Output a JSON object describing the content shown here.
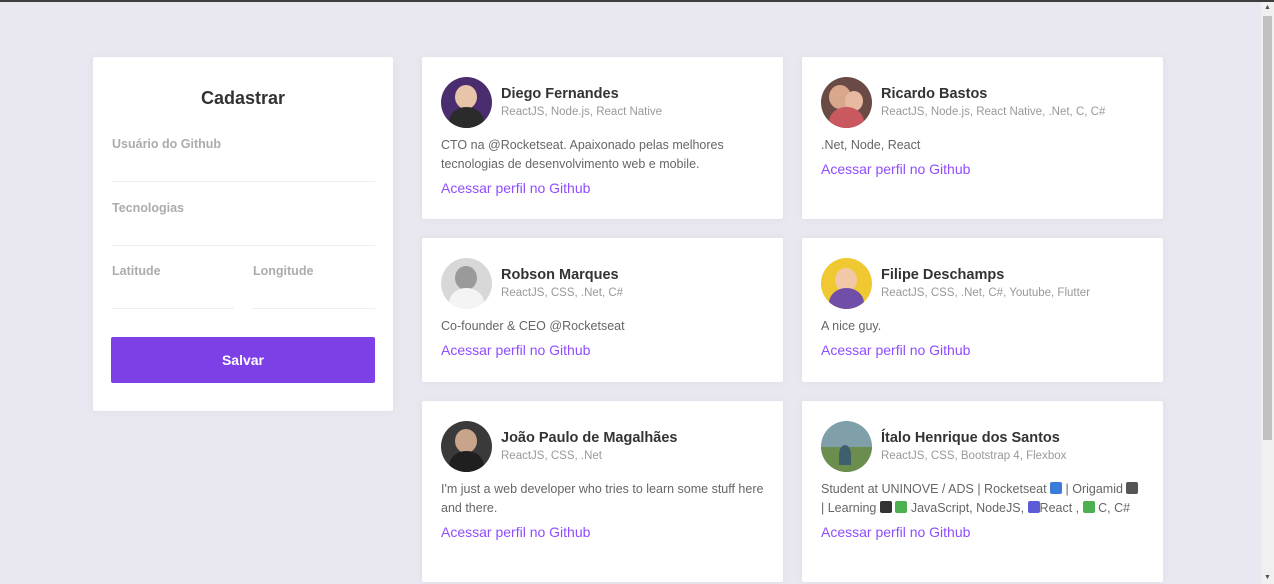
{
  "form": {
    "title": "Cadastrar",
    "github_user_label": "Usuário do Github",
    "github_user_value": "",
    "techs_label": "Tecnologias",
    "techs_value": "",
    "latitude_label": "Latitude",
    "latitude_value": "",
    "longitude_label": "Longitude",
    "longitude_value": "",
    "save_label": "Salvar"
  },
  "colors": {
    "background": "#e9e8f0",
    "accent": "#7d40e7",
    "link": "#8e4dff"
  },
  "devs": [
    {
      "name": "Diego Fernandes",
      "techs": "ReactJS, Node.js, React Native",
      "bio": "CTO na @Rocketseat. Apaixonado pelas melhores tecnologias de desenvolvimento web e mobile.",
      "link": "Acessar perfil no Github"
    },
    {
      "name": "Ricardo Bastos",
      "techs": "ReactJS, Node.js, React Native, .Net, C, C#",
      "bio": ".Net, Node, React",
      "link": "Acessar perfil no Github"
    },
    {
      "name": "Robson Marques",
      "techs": "ReactJS, CSS, .Net, C#",
      "bio": "Co-founder & CEO @Rocketseat",
      "link": "Acessar perfil no Github"
    },
    {
      "name": "Filipe Deschamps",
      "techs": "ReactJS, CSS, .Net, C#, Youtube, Flutter",
      "bio": "A nice guy.",
      "link": "Acessar perfil no Github"
    },
    {
      "name": "João Paulo de Magalhães",
      "techs": "ReactJS, CSS, .Net",
      "bio": "I'm just a web developer who tries to learn some stuff here and there.",
      "link": "Acessar perfil no Github"
    },
    {
      "name": "Ítalo Henrique dos Santos",
      "techs": "ReactJS, CSS, Bootstrap 4, Flexbox",
      "bio_parts": [
        "Student at UNINOVE / ADS | Rocketseat ",
        " | Origamid ",
        " | Learning ",
        " JavaScript, NodeJS, ",
        "React , ",
        " C, C#"
      ],
      "link": "Acessar perfil no Github"
    }
  ]
}
